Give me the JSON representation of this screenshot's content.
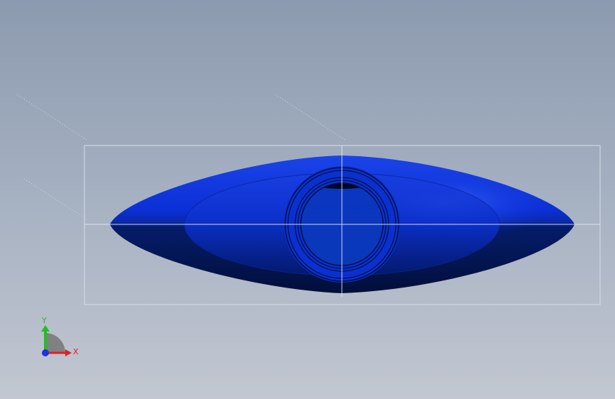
{
  "viewport": {
    "background_top": "#8c9aaf",
    "background_bottom": "#c2c7d1"
  },
  "model": {
    "body_color": "#0a2fd6",
    "highlight_color": "#2f58f0",
    "shadow_color": "#031448",
    "bore_color": "#0838b8"
  },
  "triad": {
    "x_label": "X",
    "y_label": "Y",
    "x_color": "#e02020",
    "y_color": "#20c020",
    "z_color": "#2030e0"
  }
}
